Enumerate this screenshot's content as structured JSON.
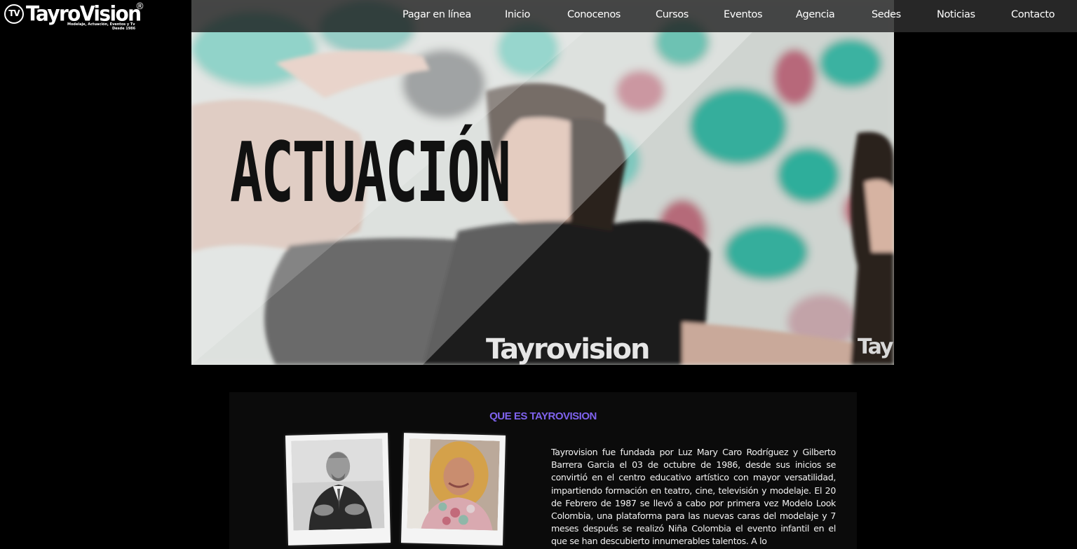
{
  "brand": {
    "badge": "TV",
    "name": "TayroVision",
    "registered": "®",
    "tagline": "Modelaje, Actuación, Eventos y Tv",
    "since": "Desde 1986"
  },
  "nav": {
    "items": [
      {
        "label": "Pagar en línea"
      },
      {
        "label": "Inicio"
      },
      {
        "label": "Conocenos"
      },
      {
        "label": "Cursos"
      },
      {
        "label": "Eventos"
      },
      {
        "label": "Agencia"
      },
      {
        "label": "Sedes"
      },
      {
        "label": "Noticias"
      },
      {
        "label": "Contacto"
      }
    ]
  },
  "hero": {
    "title": "ACTUACIÓN",
    "shirt_print": "Tayrovision"
  },
  "about": {
    "heading": "QUE ES TAYROVISION",
    "body": "Tayrovision fue fundada por Luz Mary Caro Rodríguez y Gilberto Barrera Garcia el 03 de octubre de 1986, desde sus inicios se convirtió en el centro educativo artístico con mayor versatilidad, impartiendo formación en teatro, cine, televisión y modelaje. El 20 de Febrero de 1987 se llevó a cabo por primera vez Modelo Look Colombia, una plataforma para las nuevas caras del modelaje y 7 meses después se realizó Niña Colombia el evento infantil en el que se han descubierto innumerables talentos. A lo"
  },
  "colors": {
    "accent": "#7f63ee",
    "background": "#000000",
    "nav_bar": "#2d2d2d",
    "section_bg": "#0b0b0b"
  }
}
